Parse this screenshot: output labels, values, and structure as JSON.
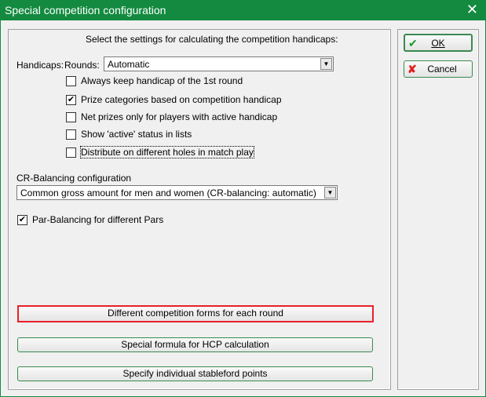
{
  "window": {
    "title": "Special competition configuration",
    "close_icon": "close-icon"
  },
  "intro": "Select the settings for calculating the competition handicaps:",
  "handicaps": {
    "label": "Handicaps:",
    "rounds_label": "Rounds:",
    "rounds_value": "Automatic"
  },
  "options": [
    {
      "label": "Always keep handicap of the 1st round",
      "checked": false
    },
    {
      "label": "Prize categories based on competition handicap",
      "checked": true
    },
    {
      "label": "Net prizes only for players with active handicap",
      "checked": false
    },
    {
      "label": "Show 'active' status in lists",
      "checked": false
    },
    {
      "label": "Distribute on different holes in match play",
      "checked": false
    }
  ],
  "cr": {
    "label": "CR-Balancing configuration",
    "value": "Common gross amount for men and women (CR-balancing: automatic)"
  },
  "par": {
    "label": "Par-Balancing for different Pars",
    "checked": true
  },
  "buttons": {
    "forms": "Different competition forms for each round",
    "formula": "Special formula for HCP calculation",
    "stableford": "Specify individual stableford points",
    "ok": "OK",
    "cancel": "Cancel"
  },
  "colors": {
    "titlebar": "#138a40",
    "highlight": "#e8202a"
  }
}
